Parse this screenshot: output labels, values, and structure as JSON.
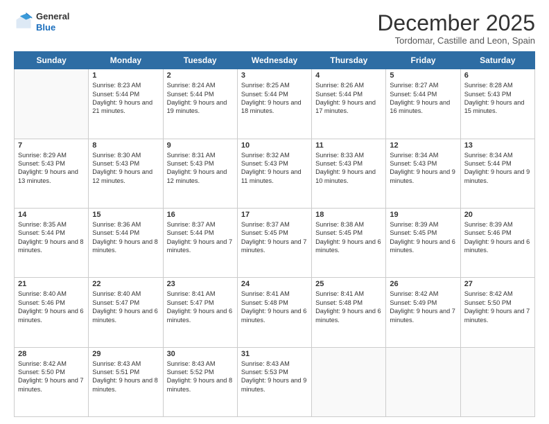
{
  "header": {
    "logo_general": "General",
    "logo_blue": "Blue",
    "month_title": "December 2025",
    "location": "Tordomar, Castille and Leon, Spain"
  },
  "days_of_week": [
    "Sunday",
    "Monday",
    "Tuesday",
    "Wednesday",
    "Thursday",
    "Friday",
    "Saturday"
  ],
  "weeks": [
    [
      {
        "day": "",
        "sunrise": "",
        "sunset": "",
        "daylight": ""
      },
      {
        "day": "1",
        "sunrise": "Sunrise: 8:23 AM",
        "sunset": "Sunset: 5:44 PM",
        "daylight": "Daylight: 9 hours and 21 minutes."
      },
      {
        "day": "2",
        "sunrise": "Sunrise: 8:24 AM",
        "sunset": "Sunset: 5:44 PM",
        "daylight": "Daylight: 9 hours and 19 minutes."
      },
      {
        "day": "3",
        "sunrise": "Sunrise: 8:25 AM",
        "sunset": "Sunset: 5:44 PM",
        "daylight": "Daylight: 9 hours and 18 minutes."
      },
      {
        "day": "4",
        "sunrise": "Sunrise: 8:26 AM",
        "sunset": "Sunset: 5:44 PM",
        "daylight": "Daylight: 9 hours and 17 minutes."
      },
      {
        "day": "5",
        "sunrise": "Sunrise: 8:27 AM",
        "sunset": "Sunset: 5:44 PM",
        "daylight": "Daylight: 9 hours and 16 minutes."
      },
      {
        "day": "6",
        "sunrise": "Sunrise: 8:28 AM",
        "sunset": "Sunset: 5:43 PM",
        "daylight": "Daylight: 9 hours and 15 minutes."
      }
    ],
    [
      {
        "day": "7",
        "sunrise": "Sunrise: 8:29 AM",
        "sunset": "Sunset: 5:43 PM",
        "daylight": "Daylight: 9 hours and 13 minutes."
      },
      {
        "day": "8",
        "sunrise": "Sunrise: 8:30 AM",
        "sunset": "Sunset: 5:43 PM",
        "daylight": "Daylight: 9 hours and 12 minutes."
      },
      {
        "day": "9",
        "sunrise": "Sunrise: 8:31 AM",
        "sunset": "Sunset: 5:43 PM",
        "daylight": "Daylight: 9 hours and 12 minutes."
      },
      {
        "day": "10",
        "sunrise": "Sunrise: 8:32 AM",
        "sunset": "Sunset: 5:43 PM",
        "daylight": "Daylight: 9 hours and 11 minutes."
      },
      {
        "day": "11",
        "sunrise": "Sunrise: 8:33 AM",
        "sunset": "Sunset: 5:43 PM",
        "daylight": "Daylight: 9 hours and 10 minutes."
      },
      {
        "day": "12",
        "sunrise": "Sunrise: 8:34 AM",
        "sunset": "Sunset: 5:43 PM",
        "daylight": "Daylight: 9 hours and 9 minutes."
      },
      {
        "day": "13",
        "sunrise": "Sunrise: 8:34 AM",
        "sunset": "Sunset: 5:44 PM",
        "daylight": "Daylight: 9 hours and 9 minutes."
      }
    ],
    [
      {
        "day": "14",
        "sunrise": "Sunrise: 8:35 AM",
        "sunset": "Sunset: 5:44 PM",
        "daylight": "Daylight: 9 hours and 8 minutes."
      },
      {
        "day": "15",
        "sunrise": "Sunrise: 8:36 AM",
        "sunset": "Sunset: 5:44 PM",
        "daylight": "Daylight: 9 hours and 8 minutes."
      },
      {
        "day": "16",
        "sunrise": "Sunrise: 8:37 AM",
        "sunset": "Sunset: 5:44 PM",
        "daylight": "Daylight: 9 hours and 7 minutes."
      },
      {
        "day": "17",
        "sunrise": "Sunrise: 8:37 AM",
        "sunset": "Sunset: 5:45 PM",
        "daylight": "Daylight: 9 hours and 7 minutes."
      },
      {
        "day": "18",
        "sunrise": "Sunrise: 8:38 AM",
        "sunset": "Sunset: 5:45 PM",
        "daylight": "Daylight: 9 hours and 6 minutes."
      },
      {
        "day": "19",
        "sunrise": "Sunrise: 8:39 AM",
        "sunset": "Sunset: 5:45 PM",
        "daylight": "Daylight: 9 hours and 6 minutes."
      },
      {
        "day": "20",
        "sunrise": "Sunrise: 8:39 AM",
        "sunset": "Sunset: 5:46 PM",
        "daylight": "Daylight: 9 hours and 6 minutes."
      }
    ],
    [
      {
        "day": "21",
        "sunrise": "Sunrise: 8:40 AM",
        "sunset": "Sunset: 5:46 PM",
        "daylight": "Daylight: 9 hours and 6 minutes."
      },
      {
        "day": "22",
        "sunrise": "Sunrise: 8:40 AM",
        "sunset": "Sunset: 5:47 PM",
        "daylight": "Daylight: 9 hours and 6 minutes."
      },
      {
        "day": "23",
        "sunrise": "Sunrise: 8:41 AM",
        "sunset": "Sunset: 5:47 PM",
        "daylight": "Daylight: 9 hours and 6 minutes."
      },
      {
        "day": "24",
        "sunrise": "Sunrise: 8:41 AM",
        "sunset": "Sunset: 5:48 PM",
        "daylight": "Daylight: 9 hours and 6 minutes."
      },
      {
        "day": "25",
        "sunrise": "Sunrise: 8:41 AM",
        "sunset": "Sunset: 5:48 PM",
        "daylight": "Daylight: 9 hours and 6 minutes."
      },
      {
        "day": "26",
        "sunrise": "Sunrise: 8:42 AM",
        "sunset": "Sunset: 5:49 PM",
        "daylight": "Daylight: 9 hours and 7 minutes."
      },
      {
        "day": "27",
        "sunrise": "Sunrise: 8:42 AM",
        "sunset": "Sunset: 5:50 PM",
        "daylight": "Daylight: 9 hours and 7 minutes."
      }
    ],
    [
      {
        "day": "28",
        "sunrise": "Sunrise: 8:42 AM",
        "sunset": "Sunset: 5:50 PM",
        "daylight": "Daylight: 9 hours and 7 minutes."
      },
      {
        "day": "29",
        "sunrise": "Sunrise: 8:43 AM",
        "sunset": "Sunset: 5:51 PM",
        "daylight": "Daylight: 9 hours and 8 minutes."
      },
      {
        "day": "30",
        "sunrise": "Sunrise: 8:43 AM",
        "sunset": "Sunset: 5:52 PM",
        "daylight": "Daylight: 9 hours and 8 minutes."
      },
      {
        "day": "31",
        "sunrise": "Sunrise: 8:43 AM",
        "sunset": "Sunset: 5:53 PM",
        "daylight": "Daylight: 9 hours and 9 minutes."
      },
      {
        "day": "",
        "sunrise": "",
        "sunset": "",
        "daylight": ""
      },
      {
        "day": "",
        "sunrise": "",
        "sunset": "",
        "daylight": ""
      },
      {
        "day": "",
        "sunrise": "",
        "sunset": "",
        "daylight": ""
      }
    ]
  ]
}
